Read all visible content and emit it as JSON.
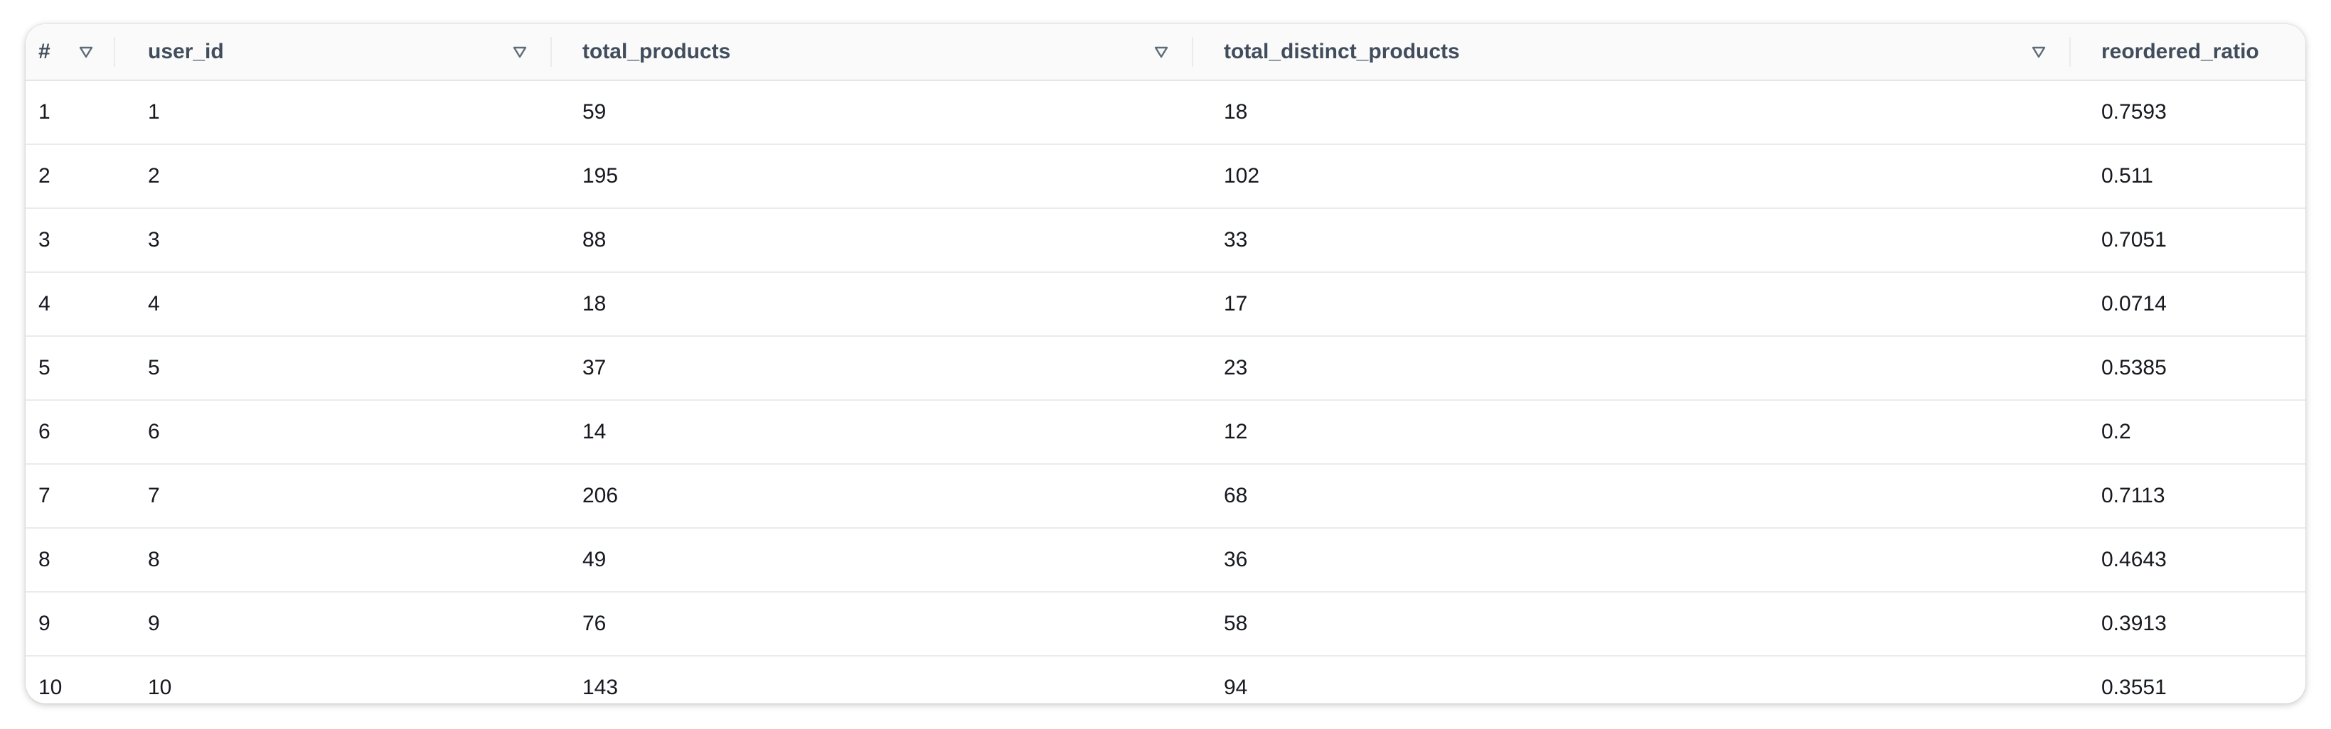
{
  "table": {
    "columns": [
      {
        "label": "#",
        "sortable": true
      },
      {
        "label": "user_id",
        "sortable": true
      },
      {
        "label": "total_products",
        "sortable": true
      },
      {
        "label": "total_distinct_products",
        "sortable": true
      },
      {
        "label": "reordered_ratio",
        "sortable": false
      }
    ],
    "rows": [
      [
        "1",
        "1",
        "59",
        "18",
        "0.7593"
      ],
      [
        "2",
        "2",
        "195",
        "102",
        "0.511"
      ],
      [
        "3",
        "3",
        "88",
        "33",
        "0.7051"
      ],
      [
        "4",
        "4",
        "18",
        "17",
        "0.0714"
      ],
      [
        "5",
        "5",
        "37",
        "23",
        "0.5385"
      ],
      [
        "6",
        "6",
        "14",
        "12",
        "0.2"
      ],
      [
        "7",
        "7",
        "206",
        "68",
        "0.7113"
      ],
      [
        "8",
        "8",
        "49",
        "36",
        "0.4643"
      ],
      [
        "9",
        "9",
        "76",
        "58",
        "0.3913"
      ],
      [
        "10",
        "10",
        "143",
        "94",
        "0.3551"
      ]
    ]
  },
  "icons": {
    "sort": "sort-triangle-down-icon"
  },
  "colors": {
    "header_bg": "#fafafa",
    "header_text": "#414d5c",
    "body_text": "#16191f",
    "row_divider": "#e9ebed",
    "sort_icon": "#5f6b7a"
  }
}
